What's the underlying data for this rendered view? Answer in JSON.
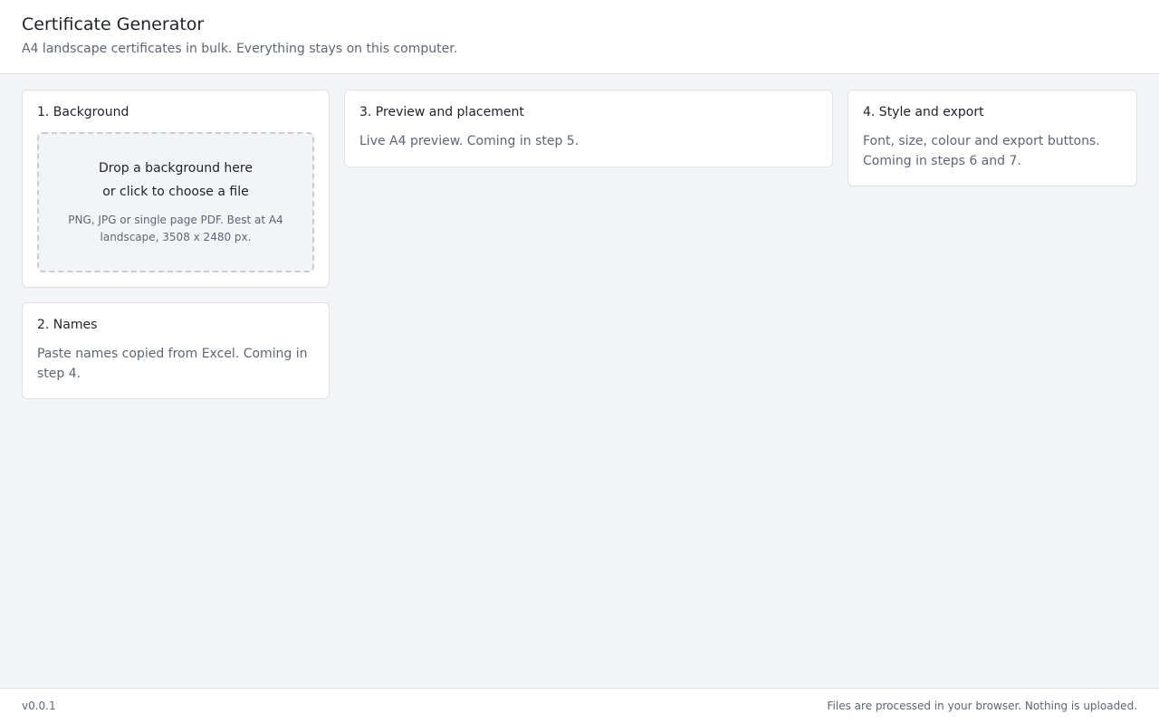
{
  "header": {
    "title": "Certificate Generator",
    "subtitle": "A4 landscape certificates in bulk. Everything stays on this computer."
  },
  "cards": {
    "background": {
      "title": "1. Background",
      "dropzone": {
        "line1": "Drop a background here",
        "line2": "or click to choose a file",
        "hint": "PNG, JPG or single page PDF. Best at A4 landscape, 3508 x 2480 px."
      }
    },
    "names": {
      "title": "2. Names",
      "description": "Paste names copied from Excel. Coming in step 4."
    },
    "preview": {
      "title": "3. Preview and placement",
      "description": "Live A4 preview. Coming in step 5."
    },
    "style": {
      "title": "4. Style and export",
      "description": "Font, size, colour and export buttons. Coming in steps 6 and 7."
    }
  },
  "footer": {
    "version": "v0.0.1",
    "privacy_note": "Files are processed in your browser. Nothing is uploaded."
  },
  "colors": {
    "page_background": "#f3f4f6",
    "card_background": "#ffffff",
    "border": "#dfe1e5",
    "text_primary": "#1f2328",
    "text_secondary": "#5f6673",
    "dropzone_border": "#c9cdd3"
  }
}
